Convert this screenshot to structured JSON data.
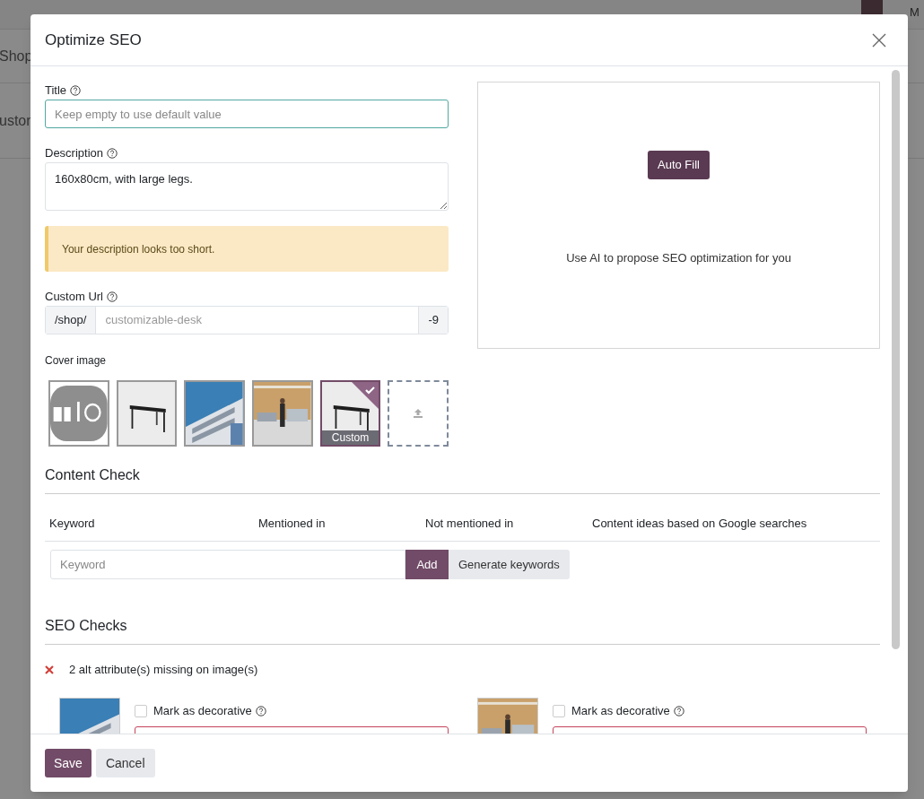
{
  "background": {
    "nav_label": "Shop",
    "tab_label": "uston",
    "user_initial": "M"
  },
  "dialog": {
    "title": "Optimize SEO",
    "title_field": {
      "label": "Title",
      "placeholder": "Keep empty to use default value"
    },
    "description_field": {
      "label": "Description",
      "value": "160x80cm, with large legs."
    },
    "warning": "Your description looks too short.",
    "url_field": {
      "label": "Custom Url",
      "prefix": "/shop/",
      "placeholder": "customizable-desk",
      "suffix": "-9"
    },
    "cover": {
      "label": "Cover image",
      "images": [
        {
          "kind": "logo",
          "selected": false
        },
        {
          "kind": "desk",
          "selected": false
        },
        {
          "kind": "building",
          "selected": false
        },
        {
          "kind": "workshop",
          "selected": false
        },
        {
          "kind": "desk",
          "selected": true,
          "caption": "Custom"
        }
      ]
    },
    "ai_panel": {
      "button": "Auto Fill",
      "text": "Use AI to propose SEO optimization for you"
    },
    "content_check": {
      "heading": "Content Check",
      "columns": [
        "Keyword",
        "Mentioned in",
        "Not mentioned in",
        "Content ideas based on Google searches"
      ],
      "keyword_placeholder": "Keyword",
      "add_button": "Add",
      "generate_button": "Generate keywords"
    },
    "seo_checks": {
      "heading": "SEO Checks",
      "failure": "2 alt attribute(s) missing on image(s)",
      "images": [
        {
          "kind": "building",
          "checkbox_label": "Mark as decorative",
          "checked": false
        },
        {
          "kind": "workshop",
          "checkbox_label": "Mark as decorative",
          "checked": false
        }
      ]
    },
    "buttons": {
      "save": "Save",
      "cancel": "Cancel"
    }
  }
}
